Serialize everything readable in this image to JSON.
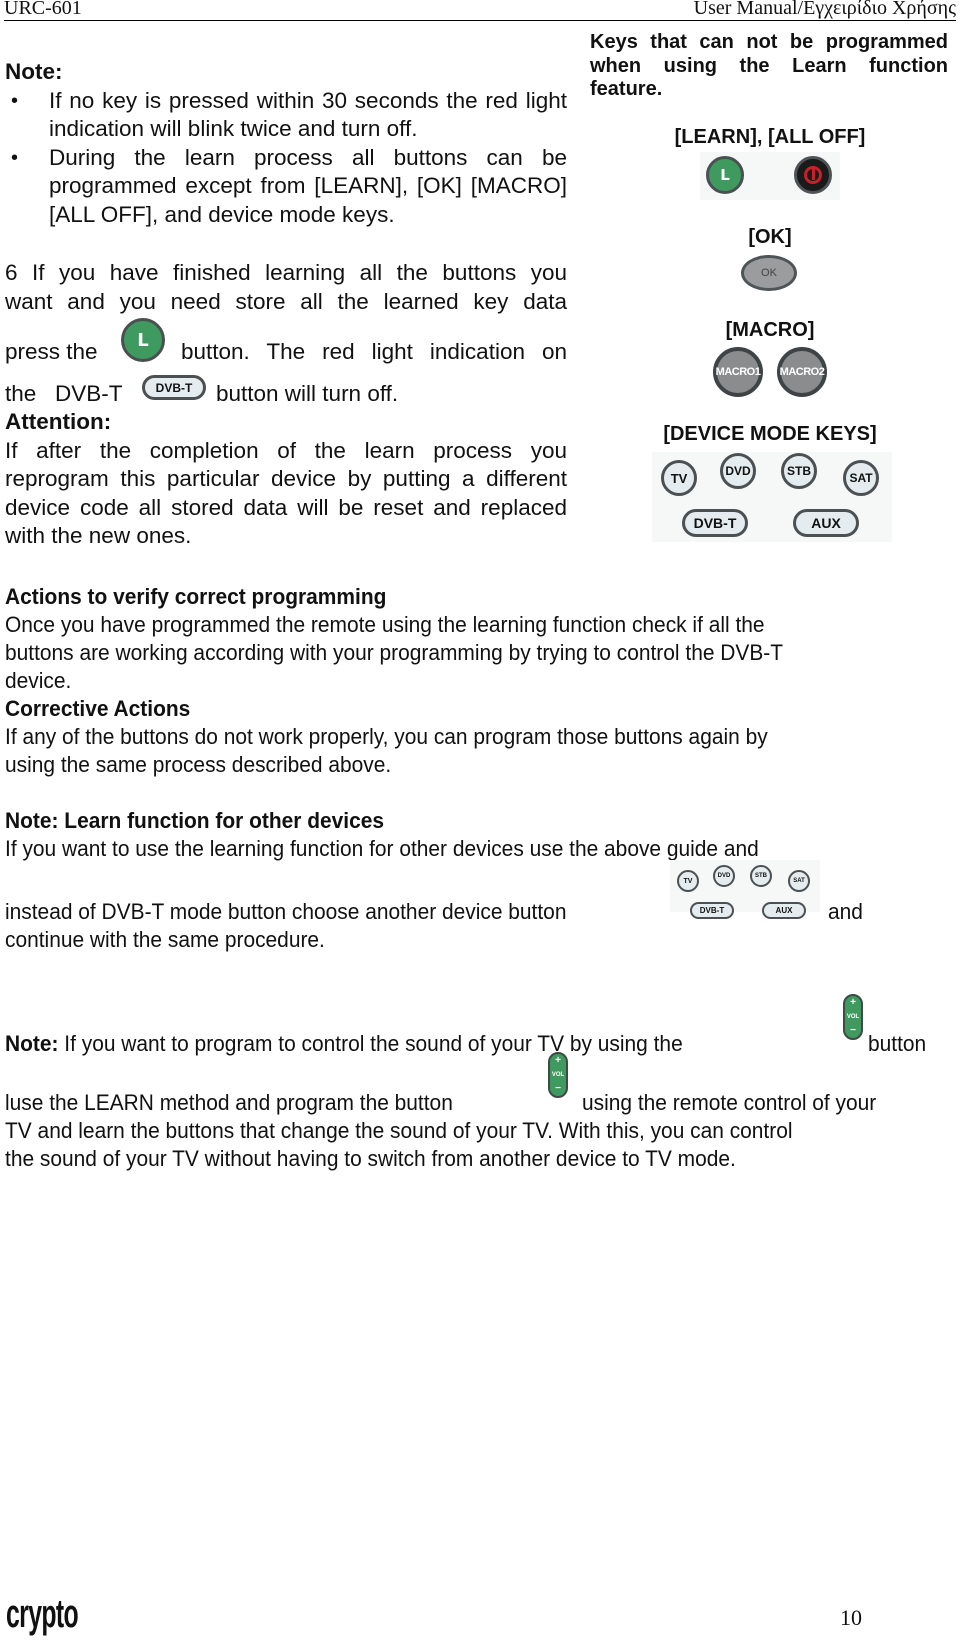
{
  "header": {
    "left": "URC-601",
    "right": "User Manual/Εγχειρίδιο Χρήσης"
  },
  "note_section": {
    "title": "Note:",
    "bullets": [
      "If no key is pressed within 30 seconds the red light indication will blink twice and turn off.",
      "During the learn process all buttons can be programmed except from [LEARN], [OK] [MACRO] [ALL OFF], and device mode keys."
    ]
  },
  "step6": {
    "line1": "6 If you have finished learning all the buttons you",
    "line2": "want and you need store all the learned key data",
    "line3_pre": "press the",
    "line3_post": "button. The red light indication on",
    "line4_pre": "the   DVB-T",
    "line4_post": "button will turn off.",
    "learn_button_label": "L",
    "dvbt_button_label": "DVB-T"
  },
  "attention": {
    "title": "Attention:",
    "text": "If after the completion of the learn process you reprogram this particular device by putting a different device code all stored data will be reset and replaced with the new ones."
  },
  "sidebar": {
    "intro": "Keys that can not be programmed when using the Learn function feature.",
    "groups": [
      {
        "title": "[LEARN], [ALL OFF]",
        "buttons": [
          "L",
          "ALL OFF"
        ]
      },
      {
        "title": "[OK]",
        "buttons": [
          "OK"
        ]
      },
      {
        "title": "[MACRO]",
        "buttons": [
          "MACRO1",
          "MACRO2"
        ]
      },
      {
        "title": "[DEVICE MODE KEYS]",
        "buttons": [
          "TV",
          "DVD",
          "STB",
          "SAT",
          "DVB-T",
          "AUX"
        ]
      }
    ]
  },
  "verify": {
    "title": "Actions to verify correct programming",
    "text": [
      "Once you have programmed the remote using the learning function check if all the",
      "buttons are working according with your programming by trying to control the DVB-T",
      "device."
    ]
  },
  "corrective": {
    "title": "Corrective Actions",
    "text": [
      "If any of the buttons do not work properly, you can program those buttons again by",
      "using the same process described above."
    ]
  },
  "other_devices": {
    "title": "Note: Learn function for other devices",
    "line1": "If you want to use the learning function for other devices use the above guide and",
    "line2_pre": "instead of DVB-T mode button choose another device button",
    "line2_post": "and",
    "line3": "continue with the same procedure.",
    "buttons": [
      "TV",
      "DVD",
      "STB",
      "SAT",
      "DVB-T",
      "AUX"
    ]
  },
  "sound_note": {
    "label": "Note:",
    "line1": " If you want to program  to  control the sound of your  TV by using the",
    "line1_post": "button",
    "line2_pre": "luse the LEARN method  and program the button",
    "line2_post": "using the remote control of your",
    "line3": "TV and learn the buttons that change the sound of your TV. With this, you can control",
    "line4": "the sound of your TV without having to switch from another  device to TV mode.",
    "vol_label": "VOL",
    "vol_plus": "+",
    "vol_minus": "−"
  },
  "footer": {
    "brand": "crypto",
    "page_number": "10"
  }
}
